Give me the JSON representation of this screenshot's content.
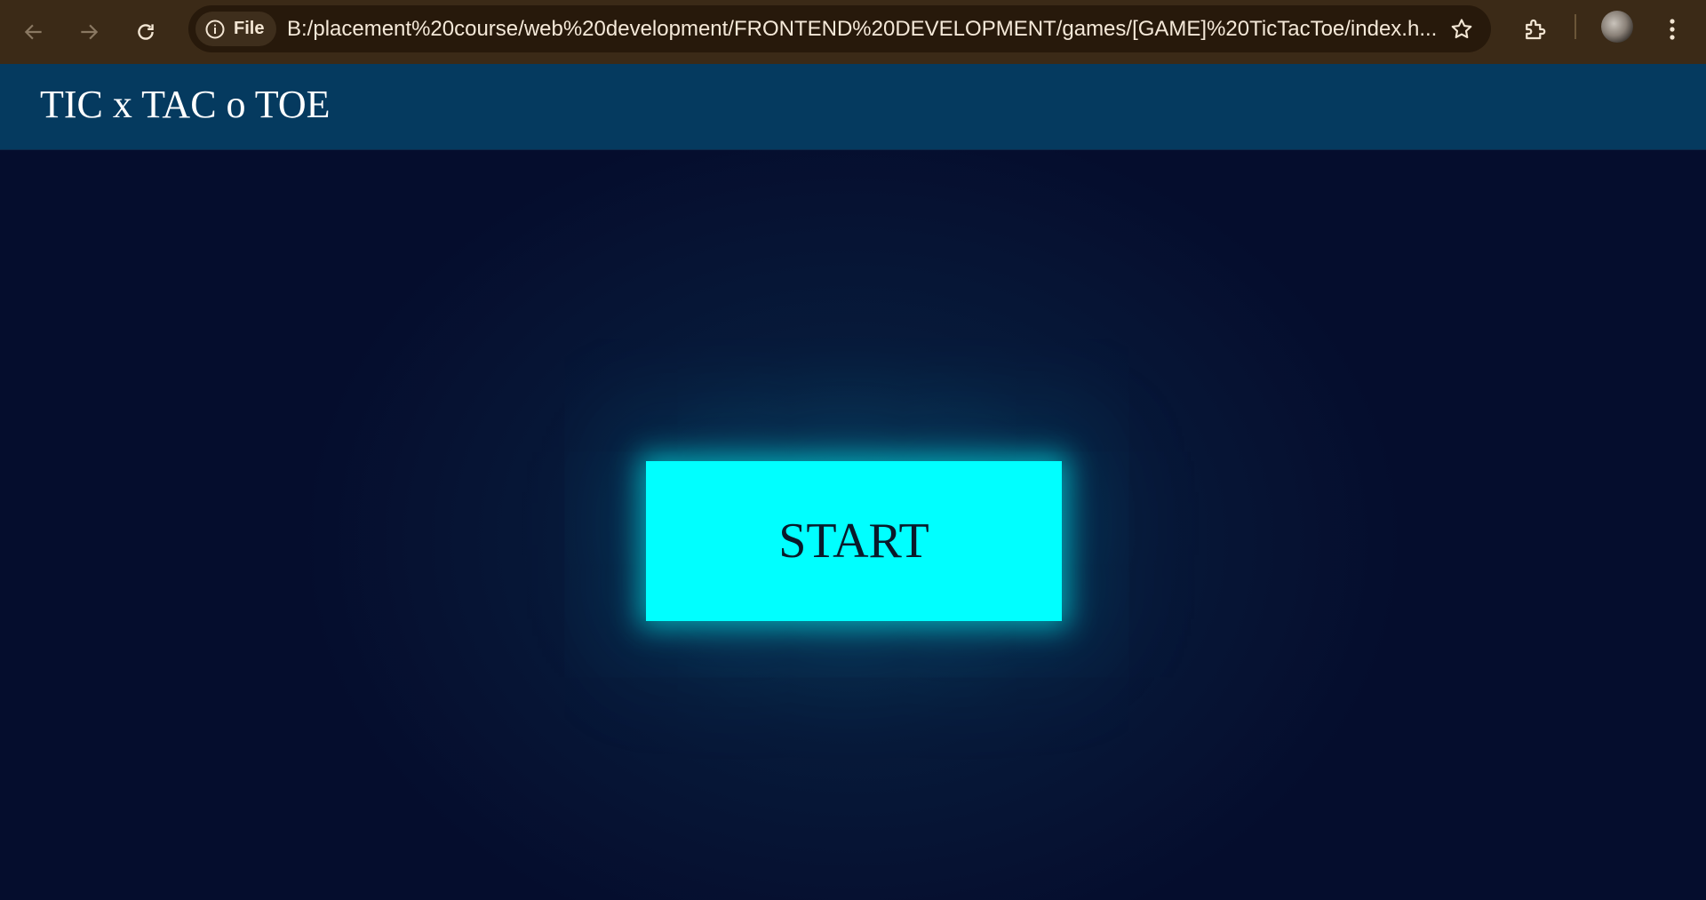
{
  "browser": {
    "site_chip_label": "File",
    "url": "B:/placement%20course/web%20development/FRONTEND%20DEVELOPMENT/games/[GAME]%20TicTacToe/index.h...",
    "icons": {
      "back": "arrow-left-icon",
      "forward": "arrow-right-icon",
      "reload": "reload-icon",
      "info": "info-icon",
      "bookmark": "star-icon",
      "extensions": "puzzle-icon",
      "profile": "avatar",
      "menu": "kebab-menu-icon"
    }
  },
  "page": {
    "title": "TIC x TAC o TOE",
    "start_label": "START"
  },
  "colors": {
    "header_bg": "#053a5f",
    "page_bg": "#050d2d",
    "start_bg": "#00ffff",
    "browser_bar": "#3b2a17"
  }
}
